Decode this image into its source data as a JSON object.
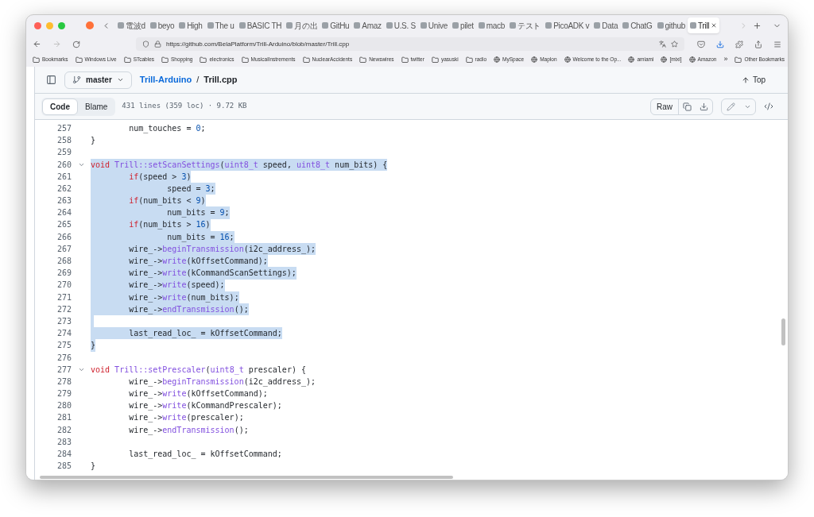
{
  "browser": {
    "tabs": [
      {
        "label": "電波d",
        "selected": false
      },
      {
        "label": "beyo",
        "selected": false
      },
      {
        "label": "High",
        "selected": false
      },
      {
        "label": "The u",
        "selected": false
      },
      {
        "label": "BASIC TH",
        "selected": false
      },
      {
        "label": "月の出",
        "selected": false
      },
      {
        "label": "GitHu",
        "selected": false
      },
      {
        "label": "Amaz",
        "selected": false
      },
      {
        "label": "U.S. S",
        "selected": false
      },
      {
        "label": "Unive",
        "selected": false
      },
      {
        "label": "pilet",
        "selected": false
      },
      {
        "label": "macb",
        "selected": false
      },
      {
        "label": "テスト",
        "selected": false
      },
      {
        "label": "PicoADK v",
        "selected": false
      },
      {
        "label": "Data",
        "selected": false
      },
      {
        "label": "ChatG",
        "selected": false
      },
      {
        "label": "github",
        "selected": false
      },
      {
        "label": "Trill",
        "selected": true
      }
    ],
    "url": "https://github.com/BelaPlatform/Trill-Arduino/blob/master/Trill.cpp",
    "bookmarks": [
      {
        "label": "Bookmarks",
        "kind": "folder"
      },
      {
        "label": "Windows Live",
        "kind": "folder"
      },
      {
        "label": "STcables",
        "kind": "folder"
      },
      {
        "label": "Shopping",
        "kind": "folder"
      },
      {
        "label": "electronics",
        "kind": "folder"
      },
      {
        "label": "MusicalInstrements",
        "kind": "folder"
      },
      {
        "label": "NuclearAccidents",
        "kind": "folder"
      },
      {
        "label": "Newswires",
        "kind": "folder"
      },
      {
        "label": "twitter",
        "kind": "folder"
      },
      {
        "label": "yasuski",
        "kind": "folder"
      },
      {
        "label": "radio",
        "kind": "folder"
      },
      {
        "label": "MySpace",
        "kind": "site"
      },
      {
        "label": "Maplon",
        "kind": "site"
      },
      {
        "label": "Welcome to the Op...",
        "kind": "site"
      },
      {
        "label": "amiami",
        "kind": "site"
      },
      {
        "label": "[mixi]",
        "kind": "site"
      },
      {
        "label": "Amazon",
        "kind": "site"
      }
    ],
    "more_bookmarks": "»",
    "other_bookmarks": "Other Bookmarks"
  },
  "file_header": {
    "branch": "master",
    "repo": "Trill-Arduino",
    "separator": "/",
    "file": "Trill.cpp",
    "top": "Top"
  },
  "toolbar": {
    "views": [
      {
        "label": "Code",
        "selected": true
      },
      {
        "label": "Blame",
        "selected": false
      }
    ],
    "info": "431 lines (359 loc) · 9.72 KB",
    "raw": "Raw"
  },
  "code": [
    {
      "number": "257",
      "fold": false,
      "selected": false,
      "segments": [
        {
          "text": "        num_touches = ",
          "kind": "plain"
        },
        {
          "text": "0",
          "kind": "number"
        },
        {
          "text": ";",
          "kind": "plain"
        }
      ]
    },
    {
      "number": "258",
      "fold": false,
      "selected": false,
      "segments": [
        {
          "text": "}",
          "kind": "plain"
        }
      ]
    },
    {
      "number": "259",
      "fold": false,
      "selected": false
    },
    {
      "number": "260",
      "fold": true,
      "selected": true,
      "segments": [
        {
          "text": "void",
          "kind": "keyword"
        },
        {
          "text": " Trill::setScanSettings",
          "kind": "entity"
        },
        {
          "text": "(",
          "kind": "plain"
        },
        {
          "text": "uint8_t",
          "kind": "entity"
        },
        {
          "text": " speed, ",
          "kind": "plain"
        },
        {
          "text": "uint8_t",
          "kind": "entity"
        },
        {
          "text": " num_bits) {",
          "kind": "plain"
        }
      ]
    },
    {
      "number": "261",
      "fold": false,
      "selected": true,
      "segments": [
        {
          "text": "        if",
          "kind": "keyword"
        },
        {
          "text": "(speed > ",
          "kind": "plain"
        },
        {
          "text": "3",
          "kind": "number"
        },
        {
          "text": ")",
          "kind": "plain"
        }
      ]
    },
    {
      "number": "262",
      "fold": false,
      "selected": true,
      "segments": [
        {
          "text": "                speed = ",
          "kind": "plain"
        },
        {
          "text": "3",
          "kind": "number"
        },
        {
          "text": ";",
          "kind": "plain"
        }
      ]
    },
    {
      "number": "263",
      "fold": false,
      "selected": true,
      "segments": [
        {
          "text": "        if",
          "kind": "keyword"
        },
        {
          "text": "(num_bits < ",
          "kind": "plain"
        },
        {
          "text": "9",
          "kind": "number"
        },
        {
          "text": ")",
          "kind": "plain"
        }
      ]
    },
    {
      "number": "264",
      "fold": false,
      "selected": true,
      "segments": [
        {
          "text": "                num_bits = ",
          "kind": "plain"
        },
        {
          "text": "9",
          "kind": "number"
        },
        {
          "text": ";",
          "kind": "plain"
        }
      ]
    },
    {
      "number": "265",
      "fold": false,
      "selected": true,
      "segments": [
        {
          "text": "        if",
          "kind": "keyword"
        },
        {
          "text": "(num_bits > ",
          "kind": "plain"
        },
        {
          "text": "16",
          "kind": "number"
        },
        {
          "text": ")",
          "kind": "plain"
        }
      ]
    },
    {
      "number": "266",
      "fold": false,
      "selected": true,
      "segments": [
        {
          "text": "                num_bits = ",
          "kind": "plain"
        },
        {
          "text": "16",
          "kind": "number"
        },
        {
          "text": ";",
          "kind": "plain"
        }
      ]
    },
    {
      "number": "267",
      "fold": false,
      "selected": true,
      "segments": [
        {
          "text": "        wire_->",
          "kind": "plain"
        },
        {
          "text": "beginTransmission",
          "kind": "entity"
        },
        {
          "text": "(i2c_address_);",
          "kind": "plain"
        }
      ]
    },
    {
      "number": "268",
      "fold": false,
      "selected": true,
      "segments": [
        {
          "text": "        wire_->",
          "kind": "plain"
        },
        {
          "text": "write",
          "kind": "entity"
        },
        {
          "text": "(kOffsetCommand);",
          "kind": "plain"
        }
      ]
    },
    {
      "number": "269",
      "fold": false,
      "selected": true,
      "segments": [
        {
          "text": "        wire_->",
          "kind": "plain"
        },
        {
          "text": "write",
          "kind": "entity"
        },
        {
          "text": "(kCommandScanSettings);",
          "kind": "plain"
        }
      ]
    },
    {
      "number": "270",
      "fold": false,
      "selected": true,
      "segments": [
        {
          "text": "        wire_->",
          "kind": "plain"
        },
        {
          "text": "write",
          "kind": "entity"
        },
        {
          "text": "(speed);",
          "kind": "plain"
        }
      ]
    },
    {
      "number": "271",
      "fold": false,
      "selected": true,
      "segments": [
        {
          "text": "        wire_->",
          "kind": "plain"
        },
        {
          "text": "write",
          "kind": "entity"
        },
        {
          "text": "(num_bits);",
          "kind": "plain"
        }
      ]
    },
    {
      "number": "272",
      "fold": false,
      "selected": true,
      "segments": [
        {
          "text": "        wire_->",
          "kind": "plain"
        },
        {
          "text": "endTransmission",
          "kind": "entity"
        },
        {
          "text": "();",
          "kind": "plain"
        }
      ]
    },
    {
      "number": "273",
      "fold": false,
      "selected": true
    },
    {
      "number": "274",
      "fold": false,
      "selected": true,
      "segments": [
        {
          "text": "        last_read_loc_ = kOffsetCommand;",
          "kind": "plain"
        }
      ]
    },
    {
      "number": "275",
      "fold": false,
      "selected": true,
      "segments": [
        {
          "text": "}",
          "kind": "plain"
        }
      ]
    },
    {
      "number": "276",
      "fold": false,
      "selected": false
    },
    {
      "number": "277",
      "fold": true,
      "selected": false,
      "segments": [
        {
          "text": "void",
          "kind": "keyword"
        },
        {
          "text": " Trill::setPrescaler",
          "kind": "entity"
        },
        {
          "text": "(",
          "kind": "plain"
        },
        {
          "text": "uint8_t",
          "kind": "entity"
        },
        {
          "text": " prescaler) {",
          "kind": "plain"
        }
      ]
    },
    {
      "number": "278",
      "fold": false,
      "selected": false,
      "segments": [
        {
          "text": "        wire_->",
          "kind": "plain"
        },
        {
          "text": "beginTransmission",
          "kind": "entity"
        },
        {
          "text": "(i2c_address_);",
          "kind": "plain"
        }
      ]
    },
    {
      "number": "279",
      "fold": false,
      "selected": false,
      "segments": [
        {
          "text": "        wire_->",
          "kind": "plain"
        },
        {
          "text": "write",
          "kind": "entity"
        },
        {
          "text": "(kOffsetCommand);",
          "kind": "plain"
        }
      ]
    },
    {
      "number": "280",
      "fold": false,
      "selected": false,
      "segments": [
        {
          "text": "        wire_->",
          "kind": "plain"
        },
        {
          "text": "write",
          "kind": "entity"
        },
        {
          "text": "(kCommandPrescaler);",
          "kind": "plain"
        }
      ]
    },
    {
      "number": "281",
      "fold": false,
      "selected": false,
      "segments": [
        {
          "text": "        wire_->",
          "kind": "plain"
        },
        {
          "text": "write",
          "kind": "entity"
        },
        {
          "text": "(prescaler);",
          "kind": "plain"
        }
      ]
    },
    {
      "number": "282",
      "fold": false,
      "selected": false,
      "segments": [
        {
          "text": "        wire_->",
          "kind": "plain"
        },
        {
          "text": "endTransmission",
          "kind": "entity"
        },
        {
          "text": "();",
          "kind": "plain"
        }
      ]
    },
    {
      "number": "283",
      "fold": false,
      "selected": false
    },
    {
      "number": "284",
      "fold": false,
      "selected": false,
      "segments": [
        {
          "text": "        last_read_loc_ = kOffsetCommand;",
          "kind": "plain"
        }
      ]
    },
    {
      "number": "285",
      "fold": false,
      "selected": false,
      "segments": [
        {
          "text": "}",
          "kind": "plain"
        }
      ]
    }
  ]
}
